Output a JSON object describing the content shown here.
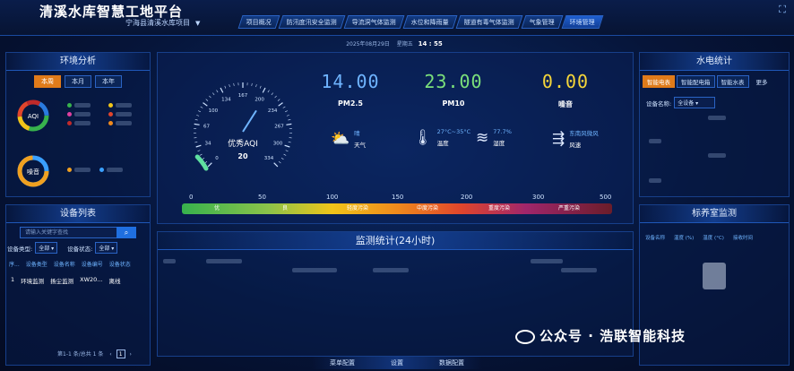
{
  "header": {
    "title": "清溪水库智慧工地平台",
    "project": "宁海县清溪水库项目",
    "nav": [
      "项目概况",
      "防汛度汛安全监测",
      "导流洞气体监测",
      "水位和降雨量",
      "隧道有毒气体监测",
      "气象管理",
      "环境管理"
    ],
    "active_nav": 6,
    "date": "2025年08月29日",
    "weekday": "星期五",
    "time": "14 : 55"
  },
  "env": {
    "title": "环境分析",
    "tabs": [
      "本周",
      "本月",
      "本年"
    ],
    "active_tab": 0,
    "aqi_label": "AQI",
    "noise_label": "噪音",
    "aqi_legend_colors": [
      "#37b24d",
      "#f0c419",
      "#e040a0",
      "#e0452c",
      "#c02a2a",
      "#f08a1c"
    ],
    "noise_legend_colors": [
      "#f0a020",
      "#3aa0ff"
    ],
    "colors": {
      "accent": "#e07b1a",
      "aqi_ring": [
        "#37b24d",
        "#f0c419",
        "#e0452c",
        "#c02a2a",
        "#2a7be0"
      ],
      "noise_ring": [
        "#f0a020",
        "#3aa0ff"
      ]
    }
  },
  "gauge": {
    "ticks": [
      "0",
      "34",
      "67",
      "100",
      "134",
      "167",
      "200",
      "234",
      "267",
      "300",
      "334"
    ],
    "label": "优秀AQI",
    "value": "20",
    "value_num": 20,
    "max": 334
  },
  "metrics": [
    {
      "value": "14.00",
      "label": "PM2.5",
      "color": "#6fb4ff"
    },
    {
      "value": "23.00",
      "label": "PM10",
      "color": "#7be07b"
    },
    {
      "value": "0.00",
      "label": "噪音",
      "color": "#f5d63a"
    }
  ],
  "weather": [
    {
      "icon": "cloud-sun-icon",
      "value": "晴",
      "label": "天气"
    },
    {
      "icon": "thermometer-icon",
      "value": "27°C~35°C",
      "label": "温度"
    },
    {
      "icon": "humidity-icon",
      "value": "77.7%",
      "label": "湿度"
    },
    {
      "icon": "wind-icon",
      "value": "东南风微风",
      "label": "风速"
    }
  ],
  "aqi_scale": {
    "ticks": [
      "0",
      "50",
      "100",
      "150",
      "200",
      "300",
      "500"
    ],
    "levels": [
      "优",
      "良",
      "轻度污染",
      "中度污染",
      "重度污染",
      "严重污染"
    ]
  },
  "devices": {
    "title": "设备列表",
    "search_placeholder": "请输入关键字查找",
    "type_label": "设备类型:",
    "type_value": "全部",
    "status_label": "设备状态:",
    "status_value": "全部",
    "columns": [
      "序...",
      "设备类型",
      "设备名称",
      "设备编号",
      "设备状态"
    ],
    "rows": [
      [
        "1",
        "环境监测",
        "扬尘监测",
        "XW20...",
        "离线"
      ]
    ],
    "pager_text": "第1-1 条/总共 1 条",
    "page": "1"
  },
  "monitor": {
    "title": "监测统计(24小时)"
  },
  "hydro": {
    "title": "水电统计",
    "tabs": [
      "智能电表",
      "智能配电箱",
      "智能水表"
    ],
    "more": "更多",
    "device_label": "设备名称:",
    "device_value": "全设备"
  },
  "curing": {
    "title": "标养室监测",
    "columns": [
      "设备名称",
      "温度 (%)",
      "温度 (°C)",
      "接收时间"
    ]
  },
  "footer": {
    "items": [
      "菜单配置",
      "设置",
      "数据配置"
    ]
  },
  "watermark": "公众号 · 浩联智能科技"
}
